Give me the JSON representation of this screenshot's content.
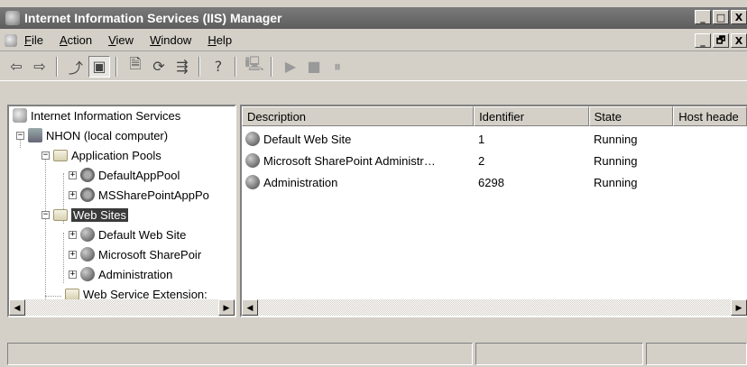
{
  "window": {
    "title": "Internet Information Services (IIS) Manager",
    "buttons": [
      "_",
      "□",
      "X"
    ]
  },
  "menu": {
    "items": [
      {
        "label": "File",
        "mnemonic": "F",
        "rest": "ile"
      },
      {
        "label": "Action",
        "mnemonic": "A",
        "rest": "ction"
      },
      {
        "label": "View",
        "mnemonic": "V",
        "rest": "iew"
      },
      {
        "label": "Window",
        "mnemonic": "W",
        "rest": "indow"
      },
      {
        "label": "Help",
        "mnemonic": "H",
        "rest": "elp"
      }
    ],
    "mdi_buttons": [
      "_",
      "🗗",
      "X"
    ]
  },
  "toolbar": {
    "back": "⇦",
    "forward": "⇨",
    "up": "⤴",
    "show_tree": "▣",
    "properties": "🗎",
    "refresh": "⟳",
    "export": "⇶",
    "help": "?",
    "computer": "🖳",
    "play": "▶",
    "stop": "■",
    "pause": "⏸"
  },
  "tree": {
    "root": "Internet Information Services",
    "computer": "NHON (local computer)",
    "app_pools": "Application Pools",
    "pool_default": "DefaultAppPool",
    "pool_sharepoint": "MSSharePointAppPo",
    "web_sites": "Web Sites",
    "site_default": "Default Web Site",
    "site_sharepoint": "Microsoft SharePoir",
    "site_admin": "Administration",
    "extensions": "Web Service Extension:"
  },
  "list": {
    "columns": [
      "Description",
      "Identifier",
      "State",
      "Host heade"
    ],
    "rows": [
      {
        "description": "Default Web Site",
        "identifier": "1",
        "state": "Running"
      },
      {
        "description": "Microsoft SharePoint Administr…",
        "identifier": "2",
        "state": "Running"
      },
      {
        "description": "Administration",
        "identifier": "6298",
        "state": "Running"
      }
    ]
  },
  "scroll": {
    "left": "◀",
    "right": "▶"
  },
  "colors": {
    "title_bar": "#5d5d5d",
    "selection": "#3a3a3a",
    "chrome": "#d4d0c8"
  }
}
